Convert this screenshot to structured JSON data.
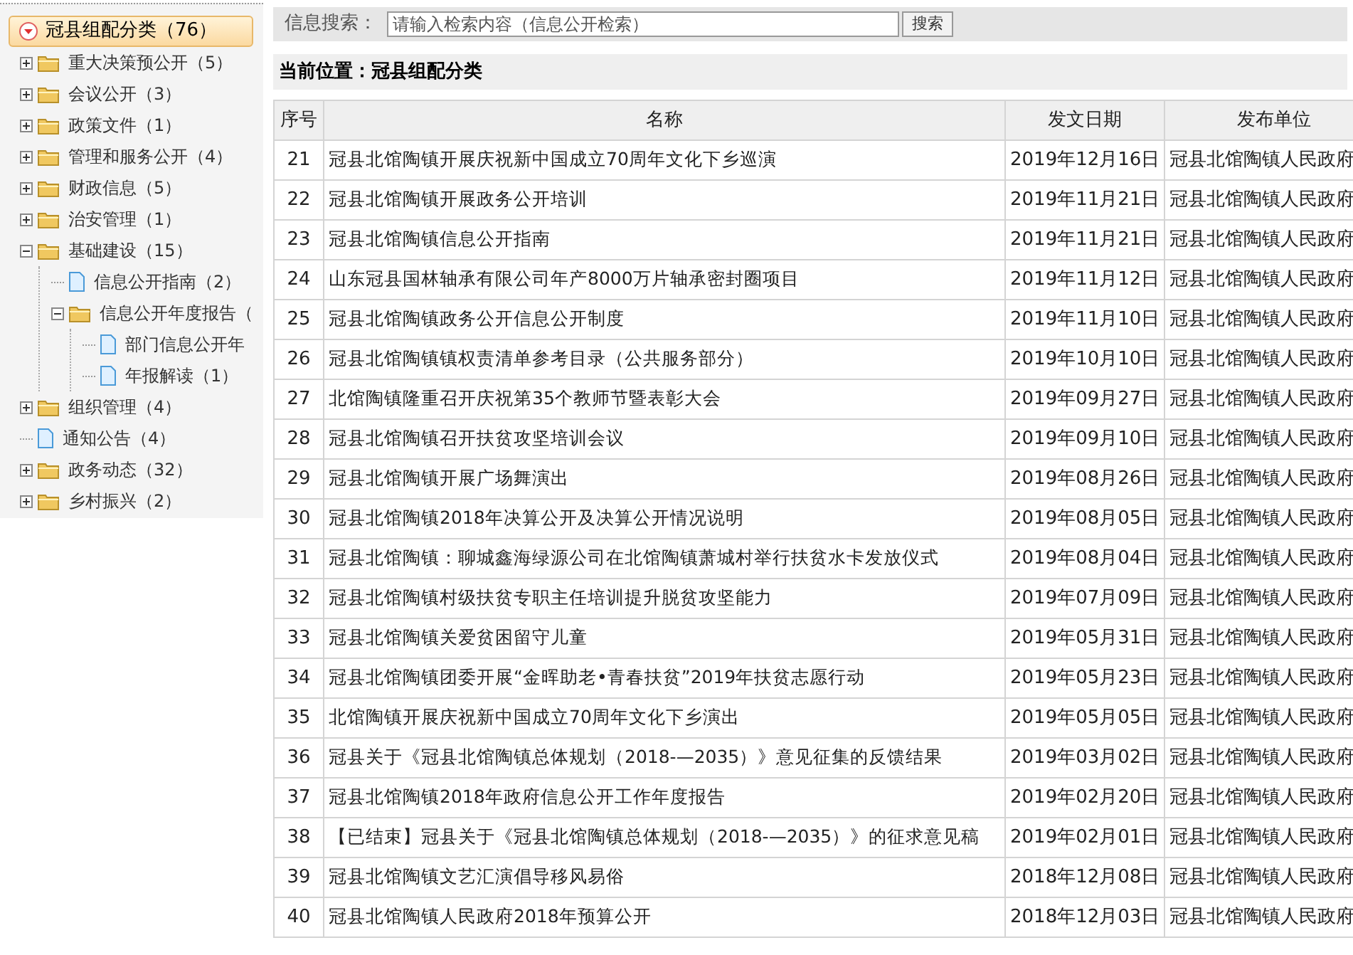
{
  "tree": {
    "label": "冠县组配分类（76）",
    "selected": true,
    "expanded": true,
    "children": [
      {
        "kind": "folder",
        "label": "重大决策预公开（5）",
        "expanded": false
      },
      {
        "kind": "folder",
        "label": "会议公开（3）",
        "expanded": false
      },
      {
        "kind": "folder",
        "label": "政策文件（1）",
        "expanded": false
      },
      {
        "kind": "folder",
        "label": "管理和服务公开（4）",
        "expanded": false
      },
      {
        "kind": "folder",
        "label": "财政信息（5）",
        "expanded": false
      },
      {
        "kind": "folder",
        "label": "治安管理（1）",
        "expanded": false
      },
      {
        "kind": "folder",
        "label": "基础建设（15）",
        "expanded": true,
        "children": [
          {
            "kind": "file",
            "label": "信息公开指南（2）"
          },
          {
            "kind": "folder",
            "label": "信息公开年度报告（",
            "expanded": true,
            "children": [
              {
                "kind": "file",
                "label": "部门信息公开年"
              },
              {
                "kind": "file",
                "label": "年报解读（1）"
              }
            ]
          }
        ]
      },
      {
        "kind": "folder",
        "label": "组织管理（4）",
        "expanded": false
      },
      {
        "kind": "file",
        "label": "通知公告（4）"
      },
      {
        "kind": "folder",
        "label": "政务动态（32）",
        "expanded": false
      },
      {
        "kind": "folder",
        "label": "乡村振兴（2）",
        "expanded": false
      }
    ]
  },
  "search": {
    "label": "信息搜索：",
    "placeholder": "请输入检索内容（信息公开检索）",
    "button": "搜索"
  },
  "breadcrumb": "当前位置：冠县组配分类",
  "table": {
    "columns": [
      "序号",
      "名称",
      "发文日期",
      "发布单位"
    ],
    "rows": [
      [
        "21",
        "冠县北馆陶镇开展庆祝新中国成立70周年文化下乡巡演",
        "2019年12月16日",
        "冠县北馆陶镇人民政府"
      ],
      [
        "22",
        "冠县北馆陶镇开展政务公开培训",
        "2019年11月21日",
        "冠县北馆陶镇人民政府"
      ],
      [
        "23",
        "冠县北馆陶镇信息公开指南",
        "2019年11月21日",
        "冠县北馆陶镇人民政府"
      ],
      [
        "24",
        "山东冠县国林轴承有限公司年产8000万片轴承密封圈项目",
        "2019年11月12日",
        "冠县北馆陶镇人民政府"
      ],
      [
        "25",
        "冠县北馆陶镇政务公开信息公开制度",
        "2019年11月10日",
        "冠县北馆陶镇人民政府"
      ],
      [
        "26",
        "冠县北馆陶镇镇权责清单参考目录（公共服务部分）",
        "2019年10月10日",
        "冠县北馆陶镇人民政府"
      ],
      [
        "27",
        "北馆陶镇隆重召开庆祝第35个教师节暨表彰大会",
        "2019年09月27日",
        "冠县北馆陶镇人民政府"
      ],
      [
        "28",
        "冠县北馆陶镇召开扶贫攻坚培训会议",
        "2019年09月10日",
        "冠县北馆陶镇人民政府"
      ],
      [
        "29",
        "冠县北馆陶镇开展广场舞演出",
        "2019年08月26日",
        "冠县北馆陶镇人民政府"
      ],
      [
        "30",
        "冠县北馆陶镇2018年决算公开及决算公开情况说明",
        "2019年08月05日",
        "冠县北馆陶镇人民政府"
      ],
      [
        "31",
        "冠县北馆陶镇：聊城鑫海绿源公司在北馆陶镇萧城村举行扶贫水卡发放仪式",
        "2019年08月04日",
        "冠县北馆陶镇人民政府"
      ],
      [
        "32",
        "冠县北馆陶镇村级扶贫专职主任培训提升脱贫攻坚能力",
        "2019年07月09日",
        "冠县北馆陶镇人民政府"
      ],
      [
        "33",
        "冠县北馆陶镇关爱贫困留守儿童",
        "2019年05月31日",
        "冠县北馆陶镇人民政府"
      ],
      [
        "34",
        "冠县北馆陶镇团委开展“金晖助老•青春扶贫”2019年扶贫志愿行动",
        "2019年05月23日",
        "冠县北馆陶镇人民政府"
      ],
      [
        "35",
        "北馆陶镇开展庆祝新中国成立70周年文化下乡演出",
        "2019年05月05日",
        "冠县北馆陶镇人民政府"
      ],
      [
        "36",
        "冠县关于《冠县北馆陶镇总体规划（2018-—2035）》意见征集的反馈结果",
        "2019年03月02日",
        "冠县北馆陶镇人民政府"
      ],
      [
        "37",
        "冠县北馆陶镇2018年政府信息公开工作年度报告",
        "2019年02月20日",
        "冠县北馆陶镇人民政府"
      ],
      [
        "38",
        "【已结束】冠县关于《冠县北馆陶镇总体规划（2018-—2035）》的征求意见稿",
        "2019年02月01日",
        "冠县北馆陶镇人民政府"
      ],
      [
        "39",
        "冠县北馆陶镇文艺汇演倡导移风易俗",
        "2018年12月08日",
        "冠县北馆陶镇人民政府"
      ],
      [
        "40",
        "冠县北馆陶镇人民政府2018年预算公开",
        "2018年12月03日",
        "冠县北馆陶镇人民政府"
      ]
    ]
  }
}
